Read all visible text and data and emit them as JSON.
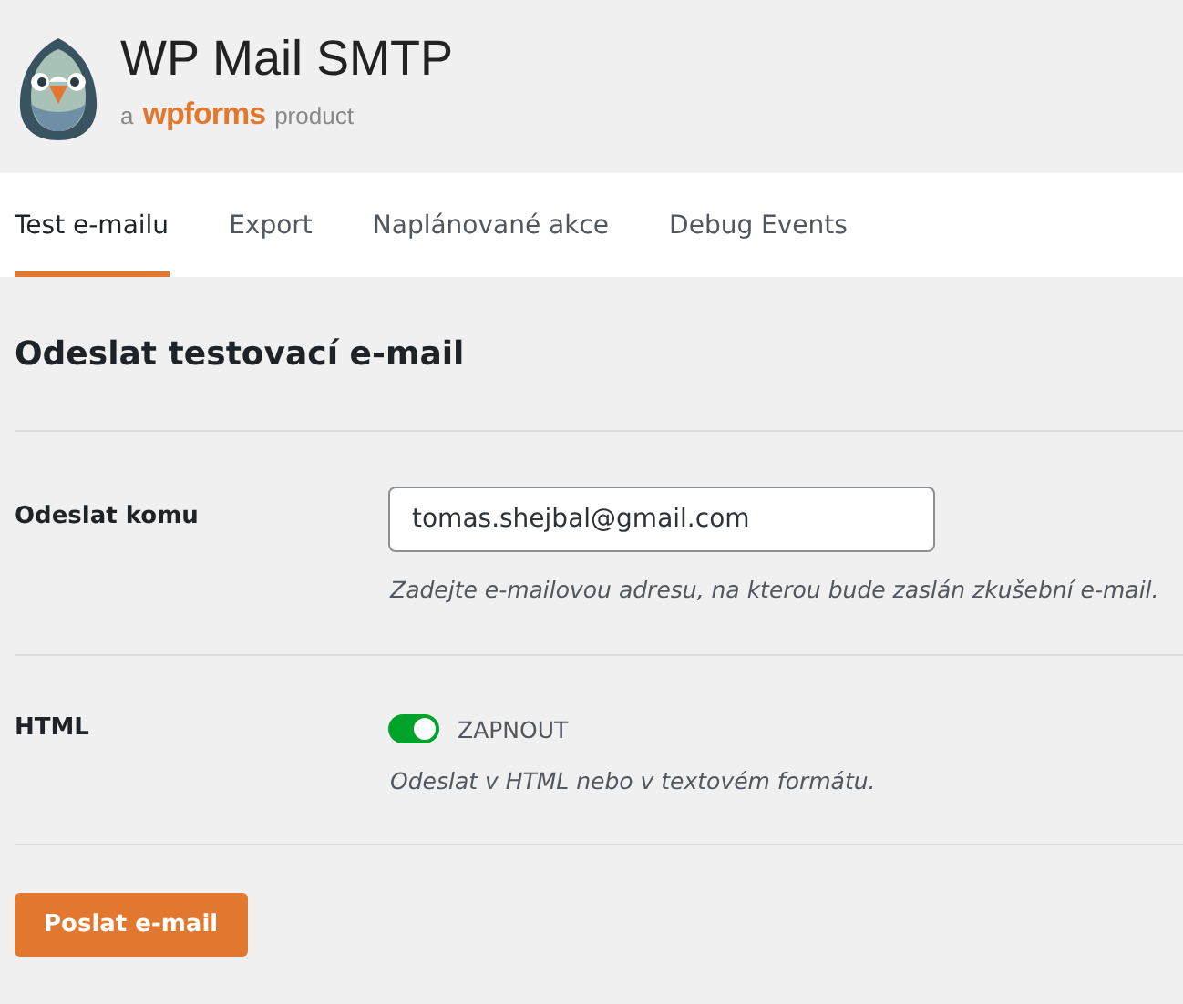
{
  "header": {
    "title": "WP Mail SMTP",
    "byline_prefix": "a",
    "byline_brand": "wpforms",
    "byline_suffix": "product"
  },
  "tabs": [
    {
      "label": "Test e-mailu",
      "selected": true
    },
    {
      "label": "Export",
      "selected": false
    },
    {
      "label": "Naplánované akce",
      "selected": false
    },
    {
      "label": "Debug Events",
      "selected": false
    }
  ],
  "section_title": "Odeslat testovací e-mail",
  "rows": [
    {
      "kind": "input",
      "label": "Odeslat komu",
      "value": "tomas.shejbal@gmail.com",
      "hint": "Zadejte e-mailovou adresu, na kterou bude zaslán zkušební e-mail."
    },
    {
      "kind": "toggle",
      "label": "HTML",
      "on": true,
      "toggle_label": "ZAPNOUT",
      "hint": "Odeslat v HTML nebo v textovém formátu."
    }
  ],
  "submit_button": "Poslat e-mail"
}
